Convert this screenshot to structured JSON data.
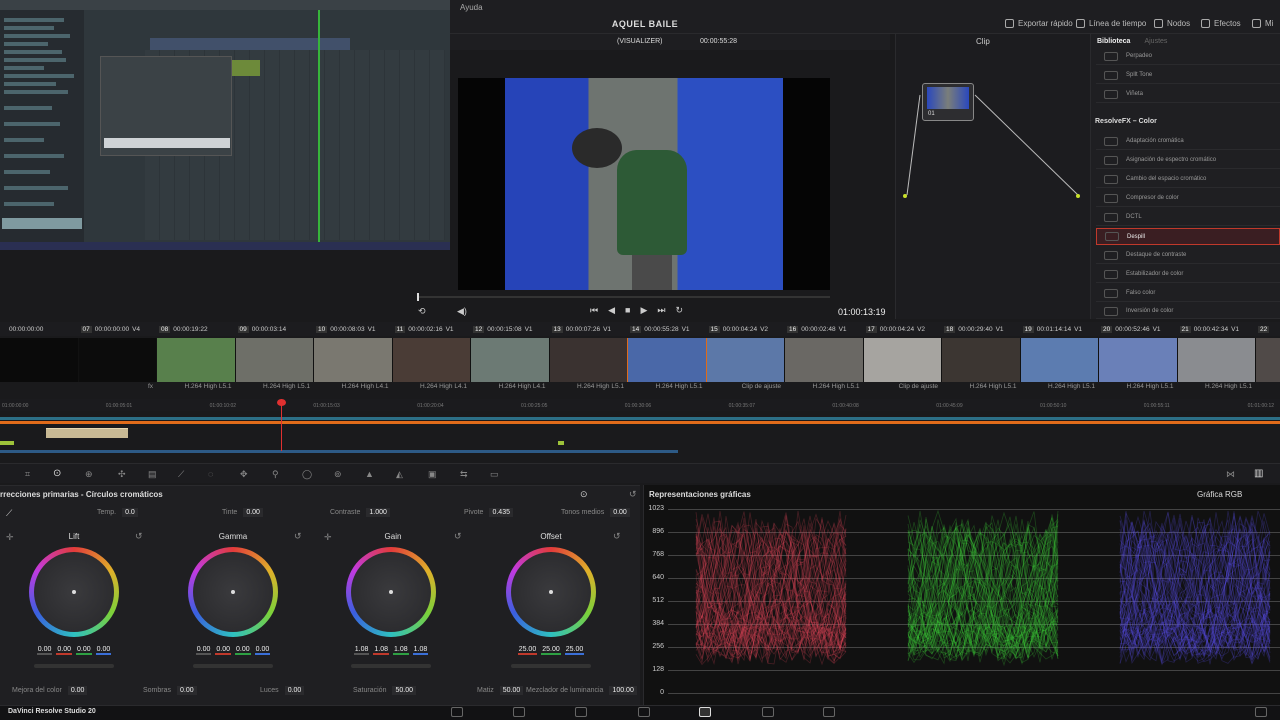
{
  "menu": {
    "help": "Ayuda"
  },
  "project": {
    "title": "AQUEL BAILE"
  },
  "header": {
    "export_label": "Exportar rápido",
    "timeline_label": "Línea de tiempo",
    "nodes_label": "Nodos",
    "effects_label": "Efectos",
    "mix_label": "Mi"
  },
  "viewer": {
    "source": "(VISUALIZER)",
    "timecode_top": "00:00:55:28",
    "timecode": "01:00:13:19",
    "clip_label": "Clip"
  },
  "node": {
    "label": "01"
  },
  "library": {
    "tab_library": "Biblioteca",
    "tab_settings": "Ajustes",
    "items_top": [
      "Perpadeo",
      "Spllt Tone",
      "Viñeta"
    ],
    "section": "ResolveFX – Color",
    "items": [
      "Adaptación cromática",
      "Asignación de espectro cromático",
      "Cambio del espacio cromático",
      "Compresor de color",
      "DCTL",
      "Despill",
      "Destaque de contraste",
      "Estabilizador de color",
      "Falso color",
      "Inversión de color"
    ],
    "selected": "Despill"
  },
  "clips": [
    {
      "num": "",
      "tc": "00:00:00:00",
      "track": "",
      "codec": "",
      "thumb": "#0a0a0a"
    },
    {
      "num": "07",
      "tc": "00:00:00:00",
      "track": "V4",
      "codec": "fx",
      "thumb": "#0c0c0c"
    },
    {
      "num": "08",
      "tc": "00:00:19:22",
      "track": "",
      "codec": "H.264 High L5.1",
      "thumb": "#58804c"
    },
    {
      "num": "09",
      "tc": "00:00:03:14",
      "track": "",
      "codec": "H.264 High L5.1",
      "thumb": "#6e6f68"
    },
    {
      "num": "10",
      "tc": "00:00:08:03",
      "track": "V1",
      "codec": "H.264 High L4.1",
      "thumb": "#7a7870"
    },
    {
      "num": "11",
      "tc": "00:00:02:16",
      "track": "V1",
      "codec": "H.264 High L4.1",
      "thumb": "#4a3c36"
    },
    {
      "num": "12",
      "tc": "00:00:15:08",
      "track": "V1",
      "codec": "H.264 High L4.1",
      "thumb": "#6c7a74"
    },
    {
      "num": "13",
      "tc": "00:00:07:26",
      "track": "V1",
      "codec": "H.264 High L5.1",
      "thumb": "#3a3230"
    },
    {
      "num": "14",
      "tc": "00:00:55:28",
      "track": "V1",
      "codec": "H.264 High L5.1",
      "thumb": "#4a68a8"
    },
    {
      "num": "15",
      "tc": "00:00:04:24",
      "track": "V2",
      "codec": "Clip de ajuste",
      "thumb": "#5c78a8"
    },
    {
      "num": "16",
      "tc": "00:00:02:48",
      "track": "V1",
      "codec": "H.264 High L5.1",
      "thumb": "#6a6864"
    },
    {
      "num": "17",
      "tc": "00:00:04:24",
      "track": "V2",
      "codec": "Clip de ajuste",
      "thumb": "#a6a4a0"
    },
    {
      "num": "18",
      "tc": "00:00:29:40",
      "track": "V1",
      "codec": "H.264 High L5.1",
      "thumb": "#3c3632"
    },
    {
      "num": "19",
      "tc": "00:01:14:14",
      "track": "V1",
      "codec": "H.264 High L5.1",
      "thumb": "#5c7cb0"
    },
    {
      "num": "20",
      "tc": "00:00:52:46",
      "track": "V1",
      "codec": "H.264 High L5.1",
      "thumb": "#6a80b8"
    },
    {
      "num": "21",
      "tc": "00:00:42:34",
      "track": "V1",
      "codec": "H.264 High L5.1",
      "thumb": "#8a8c90"
    },
    {
      "num": "22",
      "tc": "",
      "track": "",
      "codec": "",
      "thumb": "#504a48"
    }
  ],
  "ruler": [
    "01:00:00:00",
    "01:00:05:01",
    "01:00:10:02",
    "01:00:15:03",
    "01:00:20:04",
    "01:00:25:05",
    "01:00:30:06",
    "01:00:35:07",
    "01:00:40:08",
    "01:00:45:09",
    "01:00:50:10",
    "01:00:55:11",
    "01:01:00:12"
  ],
  "color": {
    "panel_title": "rrecciones primarias - Círculos cromáticos",
    "params": [
      {
        "label": "Temp.",
        "value": "0.0"
      },
      {
        "label": "Tinte",
        "value": "0.00"
      },
      {
        "label": "Contraste",
        "value": "1.000"
      },
      {
        "label": "Pivote",
        "value": "0.435"
      },
      {
        "label": "Tonos medios",
        "value": "0.00"
      }
    ],
    "wheels": [
      {
        "name": "Lift",
        "values": [
          "0.00",
          "0.00",
          "0.00",
          "0.00"
        ]
      },
      {
        "name": "Gamma",
        "values": [
          "0.00",
          "0.00",
          "0.00",
          "0.00"
        ]
      },
      {
        "name": "Gain",
        "values": [
          "1.08",
          "1.08",
          "1.08",
          "1.08"
        ]
      },
      {
        "name": "Offset",
        "values": [
          "25.00",
          "25.00",
          "25.00"
        ]
      }
    ],
    "bottom": [
      {
        "label": "Mejora del color",
        "value": "0.00"
      },
      {
        "label": "Sombras",
        "value": "0.00"
      },
      {
        "label": "Luces",
        "value": "0.00"
      },
      {
        "label": "Saturación",
        "value": "50.00"
      },
      {
        "label": "Matiz",
        "value": "50.00"
      },
      {
        "label": "Mezclador de luminancia",
        "value": "100.00"
      }
    ]
  },
  "scopes": {
    "title": "Representaciones gráficas",
    "mode": "Gráfica RGB",
    "y_labels": [
      "1023",
      "896",
      "768",
      "640",
      "512",
      "384",
      "256",
      "128",
      "0"
    ],
    "colors": {
      "red": "#e8485a",
      "green": "#3fdc3a",
      "blue": "#5a4ef0"
    }
  },
  "app": {
    "name": "DaVinci Resolve Studio 20"
  }
}
